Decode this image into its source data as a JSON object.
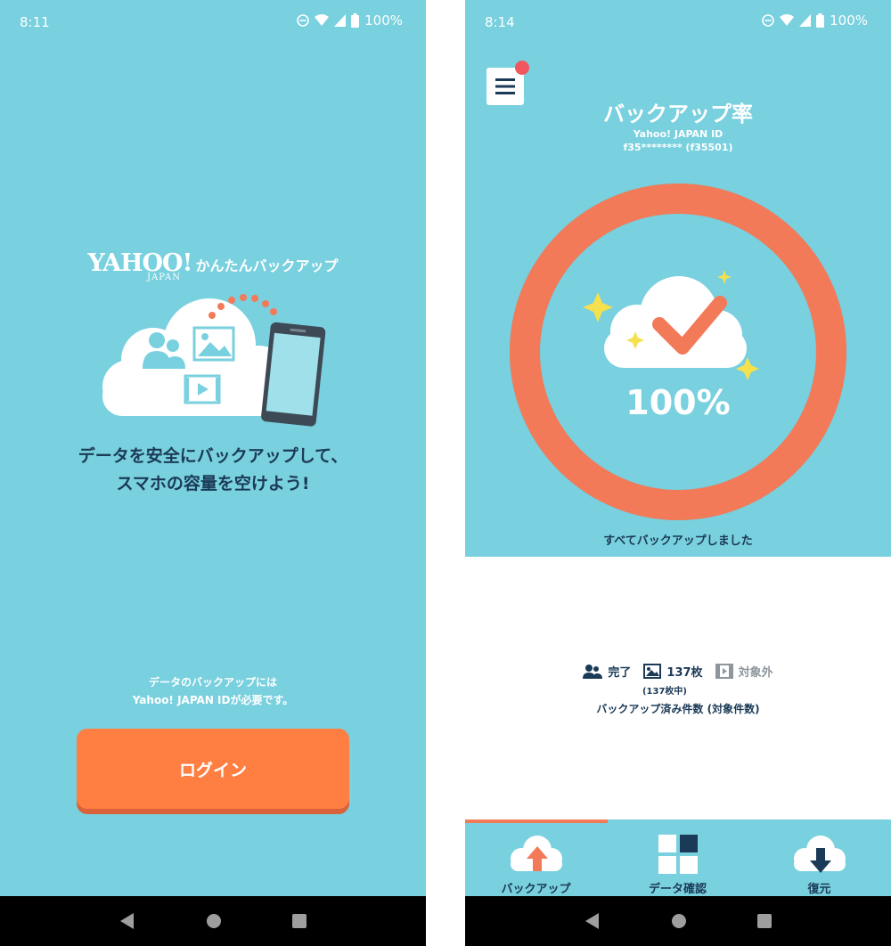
{
  "left_screen": {
    "status": {
      "time": "8:11",
      "battery": "100%"
    },
    "logo": {
      "brand": "YAHOO!",
      "brand_sub": "JAPAN",
      "app_name": "かんたんバックアップ"
    },
    "tagline": {
      "line1": "データを安全にバックアップして、",
      "line2": "スマホの容量を空けよう!"
    },
    "login_note": {
      "line1": "データのバックアップには",
      "line2": "Yahoo! JAPAN IDが必要です。"
    },
    "login_button": "ログイン"
  },
  "right_screen": {
    "status": {
      "time": "8:14",
      "battery": "100%"
    },
    "title": "バックアップ率",
    "account": {
      "label": "Yahoo! JAPAN ID",
      "id": "f35******** (f35501)"
    },
    "backup_rate": {
      "value": 1.0,
      "display": "100%"
    },
    "done_message": "すべてバックアップしました",
    "counts": {
      "contacts": "完了",
      "photos": "137枚",
      "photos_sub": "(137枚中)",
      "videos": "対象外",
      "caption": "バックアップ済み件数 (対象件数)"
    },
    "tabs": [
      {
        "label": "バックアップ",
        "icon": "cloud-upload-icon"
      },
      {
        "label": "データ確認",
        "icon": "grid-icon"
      },
      {
        "label": "復元",
        "icon": "cloud-download-icon"
      }
    ]
  },
  "colors": {
    "background": "#79d0de",
    "accent": "#ff7f43",
    "ring": "#f37a58",
    "text_dark": "#1b3a57",
    "notification": "#f2575f"
  }
}
